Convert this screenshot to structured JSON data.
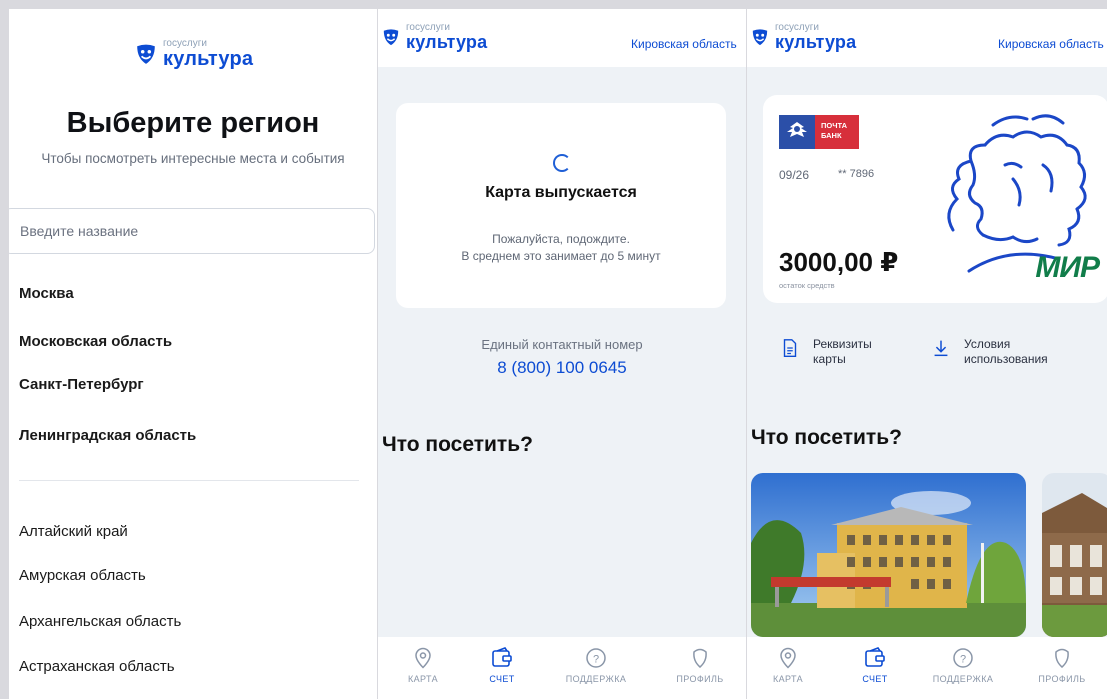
{
  "logo": {
    "small": "госуслуги",
    "big": "культура"
  },
  "region_select": {
    "title": "Выберите регион",
    "subtitle": "Чтобы посмотреть интересные места и события",
    "search_placeholder": "Введите название",
    "popular": [
      "Москва",
      "Московская область",
      "Санкт-Петербург",
      "Ленинградская область"
    ],
    "all": [
      "Алтайский край",
      "Амурская область",
      "Архангельская область",
      "Астраханская область"
    ]
  },
  "header": {
    "region": "Кировская область"
  },
  "issuing": {
    "title": "Карта выпускается",
    "line1": "Пожалуйста, подождите.",
    "line2": "В среднем это занимает до 5 минут",
    "contact_label": "Единый контактный номер",
    "contact_phone": "8 (800) 100 0645"
  },
  "visit_title": "Что посетить?",
  "card": {
    "bank_name_1": "ПОЧТА",
    "bank_name_2": "БАНК",
    "expiry": "09/26",
    "number": "** 7896",
    "balance": "3000,00 ₽",
    "balance_label": "остаток средств",
    "payment_system": "МИР",
    "actions": [
      {
        "line1": "Реквизиты",
        "line2": "карты",
        "icon": "document-icon"
      },
      {
        "line1": "Условия",
        "line2": "использования",
        "icon": "download-icon"
      }
    ]
  },
  "nav": [
    "КАРТА",
    "СЧЕТ",
    "ПОДДЕРЖКА",
    "ПРОФИЛЬ"
  ],
  "colors": {
    "brand": "#0d4cd3",
    "bank_red": "#d72f3b",
    "mir_green": "#117d4a",
    "background": "#eef2f6"
  }
}
